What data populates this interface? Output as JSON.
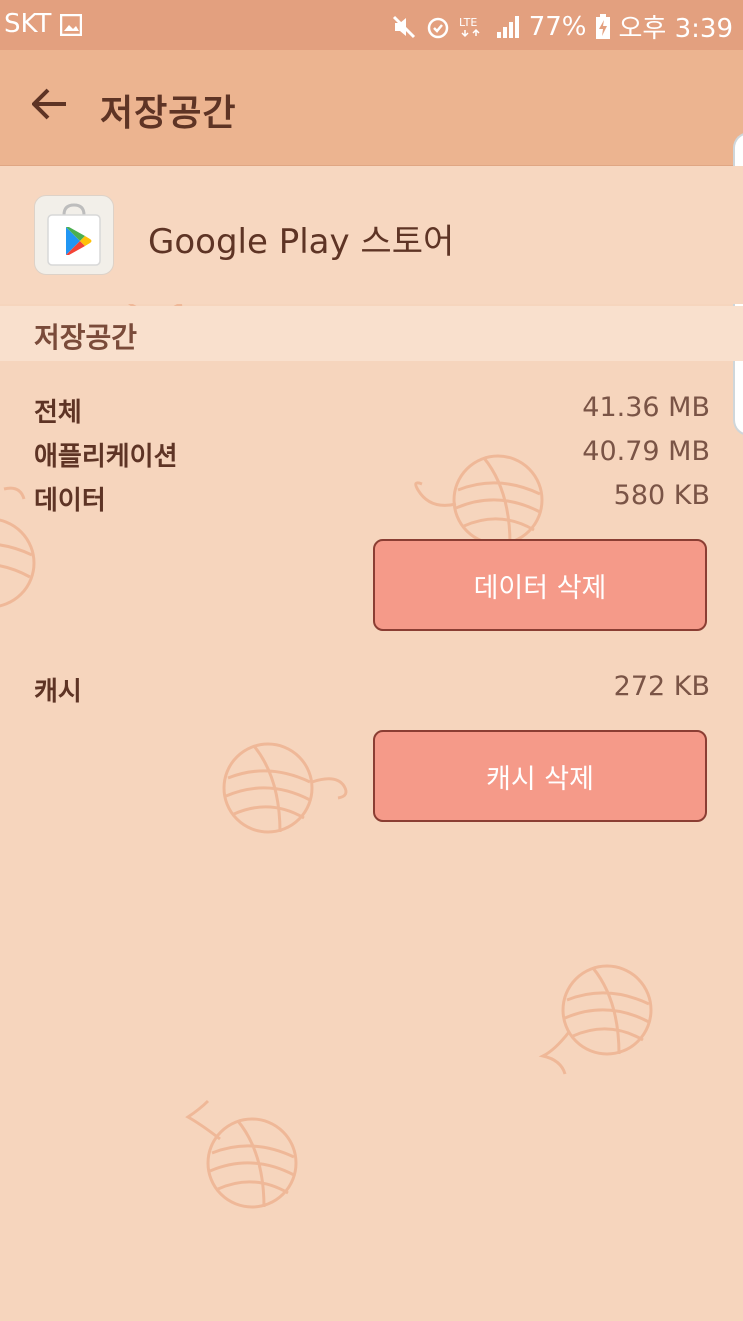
{
  "status_bar": {
    "carrier": "SKT",
    "battery": "77%",
    "time": "오후 3:39"
  },
  "app_bar": {
    "title": "저장공간"
  },
  "app": {
    "name": "Google Play 스토어",
    "icon": "google-play-store-icon"
  },
  "storage": {
    "section_title": "저장공간",
    "rows": [
      {
        "label": "전체",
        "value": "41.36 MB"
      },
      {
        "label": "애플리케이션",
        "value": "40.79 MB"
      },
      {
        "label": "데이터",
        "value": "580 KB"
      }
    ],
    "clear_data_label": "데이터 삭제",
    "cache_label": "캐시",
    "cache_value": "272 KB",
    "clear_cache_label": "캐시 삭제"
  },
  "colors": {
    "status_bar": "#e3a07f",
    "app_bar": "#ecb490",
    "background": "#f6d5bd",
    "button": "#f59a89",
    "button_border": "#8b3e33",
    "text": "#5e3425"
  }
}
